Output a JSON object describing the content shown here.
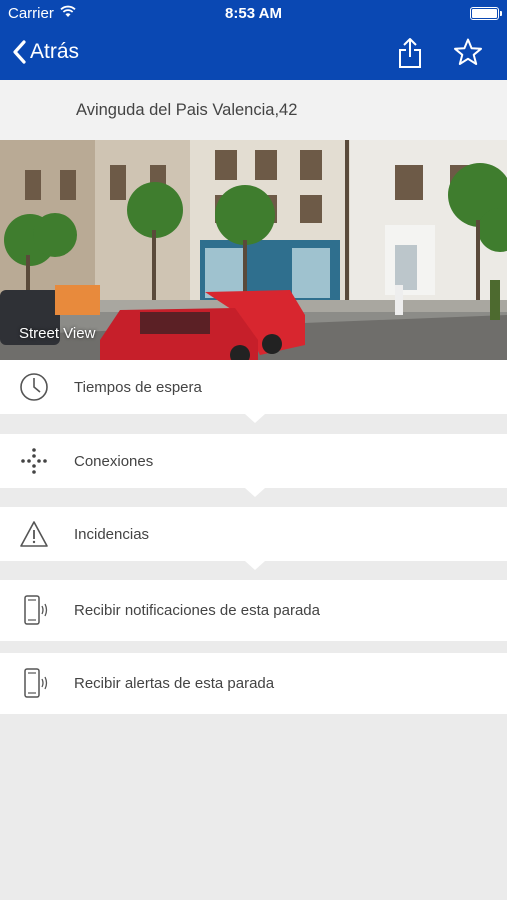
{
  "status_bar": {
    "carrier": "Carrier",
    "time": "8:53 AM"
  },
  "nav": {
    "back_label": "Atrás",
    "share_icon": "share-icon",
    "favorite_icon": "star-icon"
  },
  "stop": {
    "address": "Avinguda del Pais Valencia,42"
  },
  "street_view": {
    "label": "Street View"
  },
  "menu": [
    {
      "label": "Tiempos de espera",
      "icon": "clock-icon"
    },
    {
      "label": "Conexiones",
      "icon": "connections-icon"
    },
    {
      "label": "Incidencias",
      "icon": "warning-icon"
    },
    {
      "label": "Recibir notificaciones de esta parada",
      "icon": "phone-notification-icon"
    },
    {
      "label": "Recibir alertas de esta parada",
      "icon": "phone-alert-icon"
    }
  ],
  "colors": {
    "header_blue": "#0a48b3",
    "background": "#ebebeb"
  }
}
